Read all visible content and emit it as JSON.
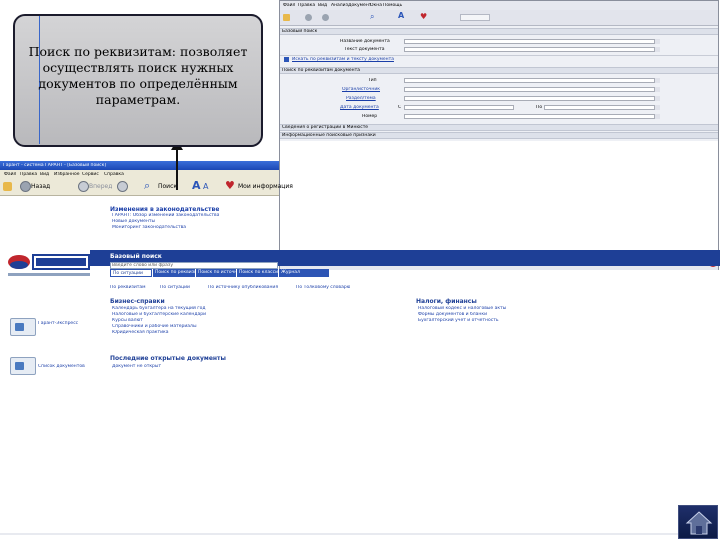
{
  "callout": {
    "text": "Поиск по реквизитам: позволяет осуществлять поиск нужных документов по определённым параметрам."
  },
  "browser": {
    "titlebar": "Гарант - система ГАРАНТ - [Базовый поиск]",
    "menu": [
      "Файл",
      "Правка",
      "Вид",
      "Избранное",
      "Сервис",
      "Справка"
    ],
    "toolbar": {
      "back_label": "Назад",
      "forward_label": "Вперед",
      "search_label": "Поиск",
      "favorites_label": "Мои информация"
    }
  },
  "search_window": {
    "menu": [
      "Файл",
      "Правка",
      "Вид",
      "Анализ",
      "Документ",
      "Окна",
      "Помощь"
    ],
    "sections": [
      "Базовый поиск",
      "Поиск по реквизитам документа",
      "Сведения о регистрации в Минюсте",
      "Информационные поисковые признаки"
    ],
    "rows_top": [
      "Название документа",
      "Текст документа"
    ],
    "rows_mid": [
      "Тип",
      "Орган/источник",
      "Раздел/тема",
      "Дата документа",
      "Номер"
    ],
    "date_from_label": "С",
    "date_to_label": "По",
    "link_label": "Искать по реквизитам и тексту документа",
    "status_label": "Искать среди документов"
  },
  "page": {
    "changes_heading": "Изменения в законодательстве",
    "changes_items": [
      "ГАРАНТ: Обзор изменений законодательства",
      "Новые документы",
      "Мониторинг законодательства"
    ],
    "basic_search_label": "Базовый поиск",
    "search_placeholder": "Введите слово или фразу",
    "tabs": [
      "По ситуации",
      "Поиск по реквизитам",
      "Поиск по источнику",
      "Поиск по классификатору",
      "Журнал"
    ],
    "quick_links": [
      "По реквизитам",
      "По ситуации",
      "По источнику опубликования",
      "По Толковому словарю"
    ],
    "business_heading": "Бизнес-справки",
    "business_items": [
      "Календарь бухгалтера на текущий год",
      "Налоговые и бухгалтерские календари",
      "Курсы валют",
      "Справочники и рабочие материалы",
      "Юридическая практика"
    ],
    "finance_heading": "Налоги, финансы",
    "finance_items": [
      "Налоговый кодекс и налоговые акты",
      "Формы документов и бланки",
      "Бухгалтерский учет и отчетность"
    ],
    "recent_heading": "Последние открытые документы",
    "recent_items": [
      "Документ не открыт"
    ],
    "side_buttons": [
      "Гарант-Экспресс",
      "Список документов"
    ]
  },
  "colors": {
    "brand_blue": "#1e3f96",
    "accent_red": "#c0262d"
  }
}
